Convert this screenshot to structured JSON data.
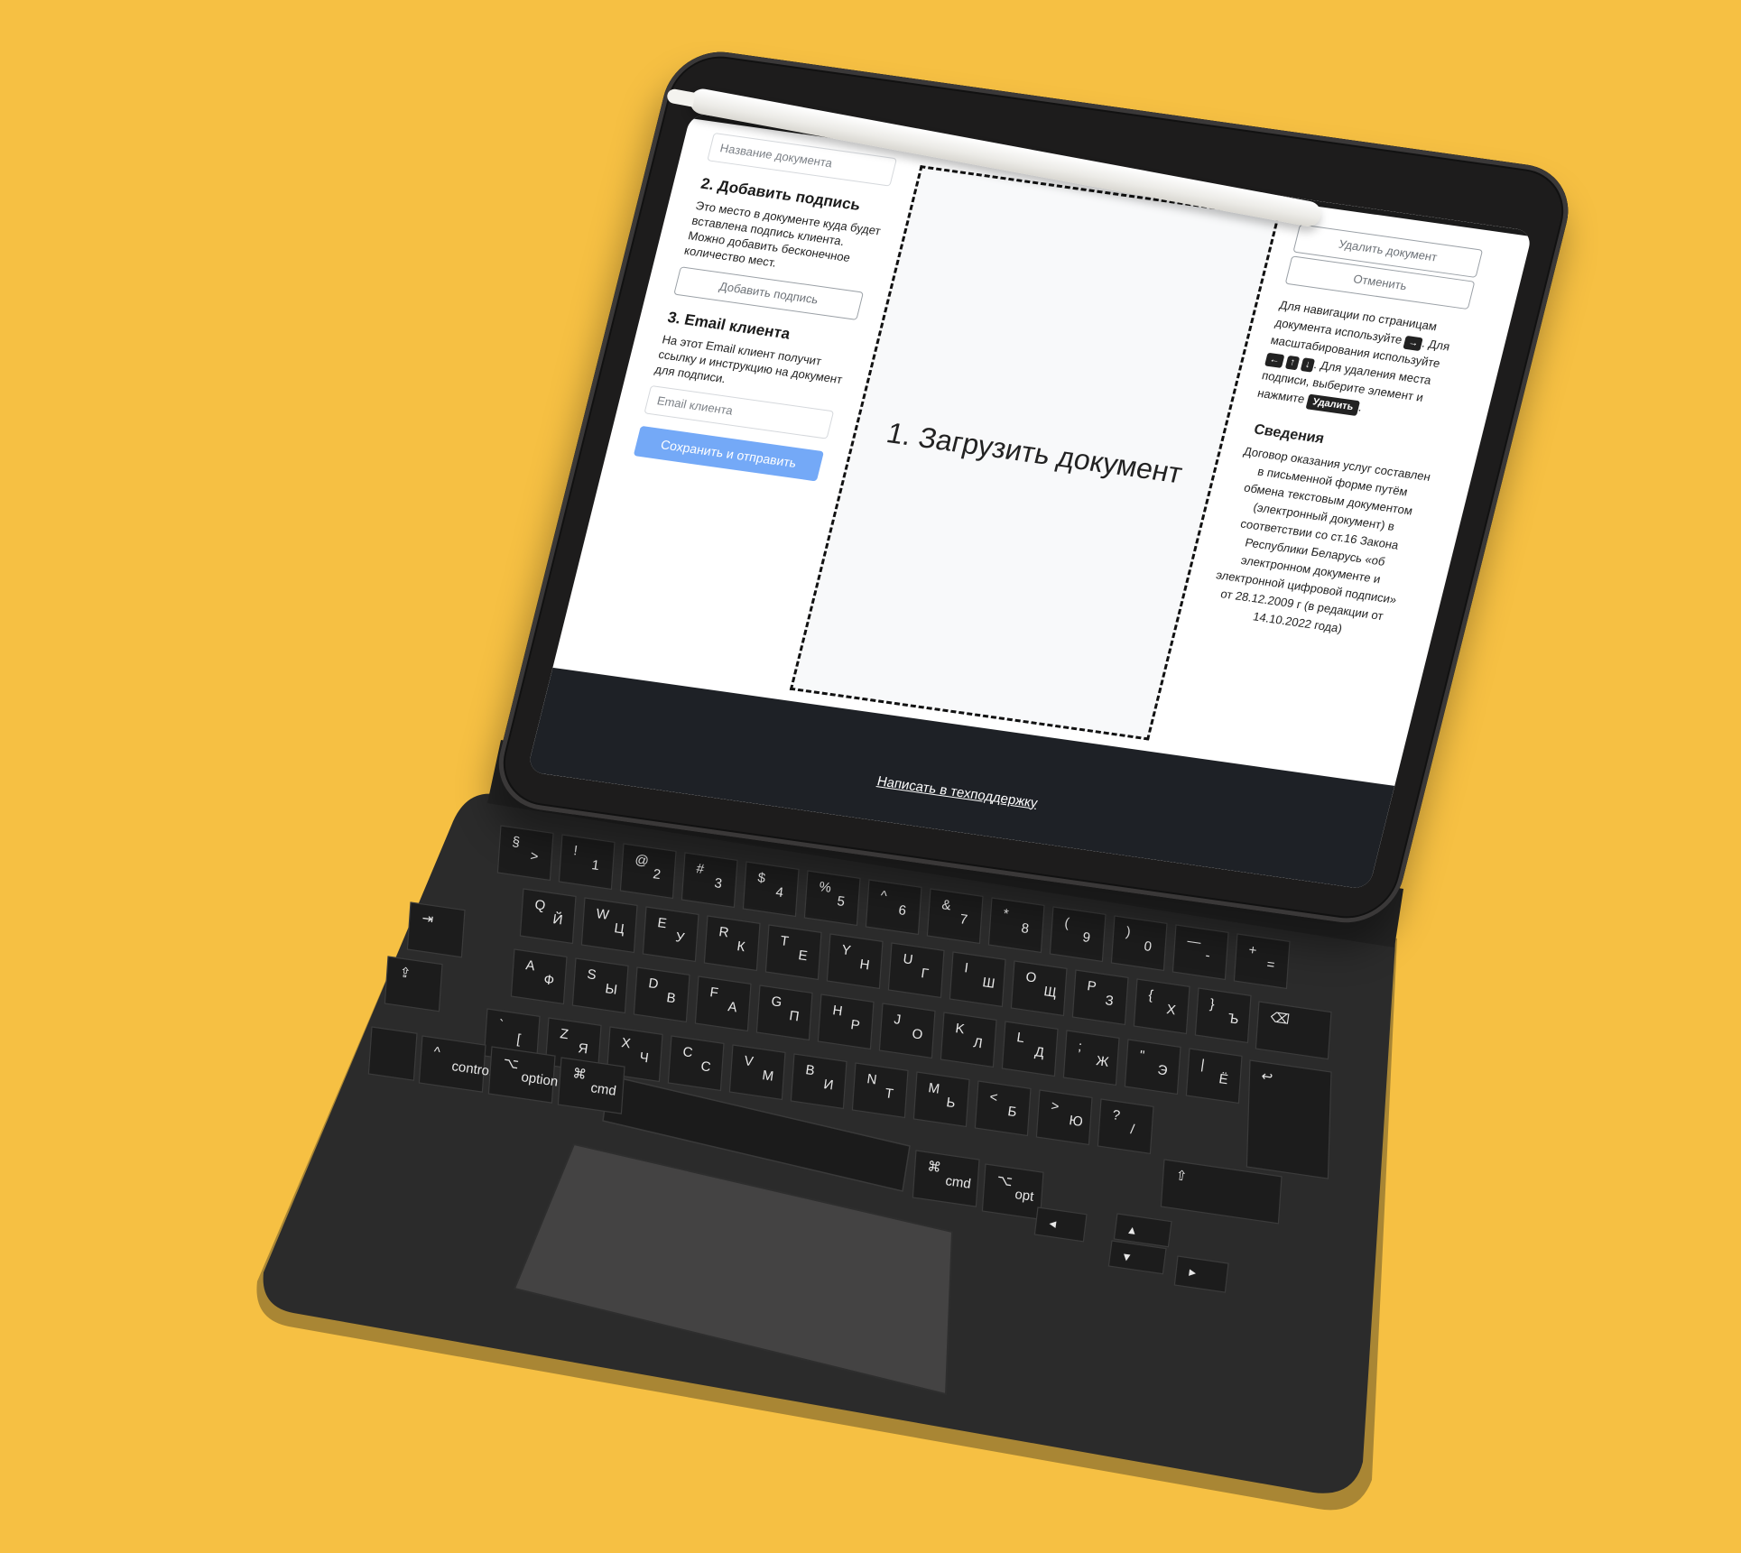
{
  "form": {
    "doc_name_placeholder": "Название документа",
    "step2_title": "2. Добавить подпись",
    "step2_text": "Это место в документе куда будет вставлена подпись клиента. Можно добавить бесконечное количество мест.",
    "add_signature_label": "Добавить подпись",
    "step3_title": "3. Email клиента",
    "step3_text": "На этот Email клиент получит ссылку и инструкцию на документ для подписи.",
    "email_placeholder": "Email клиента",
    "submit_label": "Сохранить и отправить"
  },
  "upload": {
    "label": "1. Загрузить документ"
  },
  "actions": {
    "delete_label": "Удалить документ",
    "cancel_label": "Отменить"
  },
  "help": {
    "nav_text": "Для навигации по страницам документа используйте",
    "key_right": "→",
    "zoom_text": ". Для масштабирования используйте",
    "key_left": "←",
    "key_up": "↑",
    "key_down": "↓",
    "delete_text": ". Для удаления места подписи, выберите элемент и нажмите",
    "key_delete": "Удалить",
    "end": "."
  },
  "info": {
    "title": "Сведения",
    "text": "Договор оказания услуг составлен в письменной форме путём обмена текстовым документом (электронный документ) в соответствии со ст.16 Закона Республики Беларусь «об электронном документе и электронной цифровой подписи» от 28.12.2009 г (в редакции от 14.10.2022 года)"
  },
  "footer": {
    "support_link": "Написать в техподдержку"
  },
  "keyboard": {
    "row1": [
      "§ >",
      "! 1",
      "@ 2",
      "# 3",
      "$ 4",
      "% 5",
      "^ 6",
      "& 7",
      "* 8",
      "( 9",
      ") 0",
      "— -",
      "+ ="
    ],
    "row2": [
      "Q Й",
      "W Ц",
      "E У",
      "R К",
      "T Е",
      "Y Н",
      "U Г",
      "I Ш",
      "O Щ",
      "P З",
      "{ Х",
      "} Ъ"
    ],
    "row3": [
      "A Ф",
      "S Ы",
      "D В",
      "F А",
      "G П",
      "H Р",
      "J О",
      "K Л",
      "L Д",
      "; Ж",
      "\" Э",
      "| Ё"
    ],
    "row4": [
      "` [",
      "Z Я",
      "X Ч",
      "C С",
      "V М",
      "B И",
      "N Т",
      "M Ь",
      "< Б",
      "> Ю",
      "? /"
    ],
    "mods": {
      "control": "control",
      "option": "option",
      "cmd": "cmd",
      "cmd_right": "cmd",
      "opt_right": "opt",
      "cmd_symbol": "⌘",
      "opt_symbol": "⌥",
      "ctrl_symbol": "^"
    }
  },
  "colors": {
    "background": "#F6C043",
    "primary_button": "#74a9f7",
    "footer": "#1e2126"
  }
}
